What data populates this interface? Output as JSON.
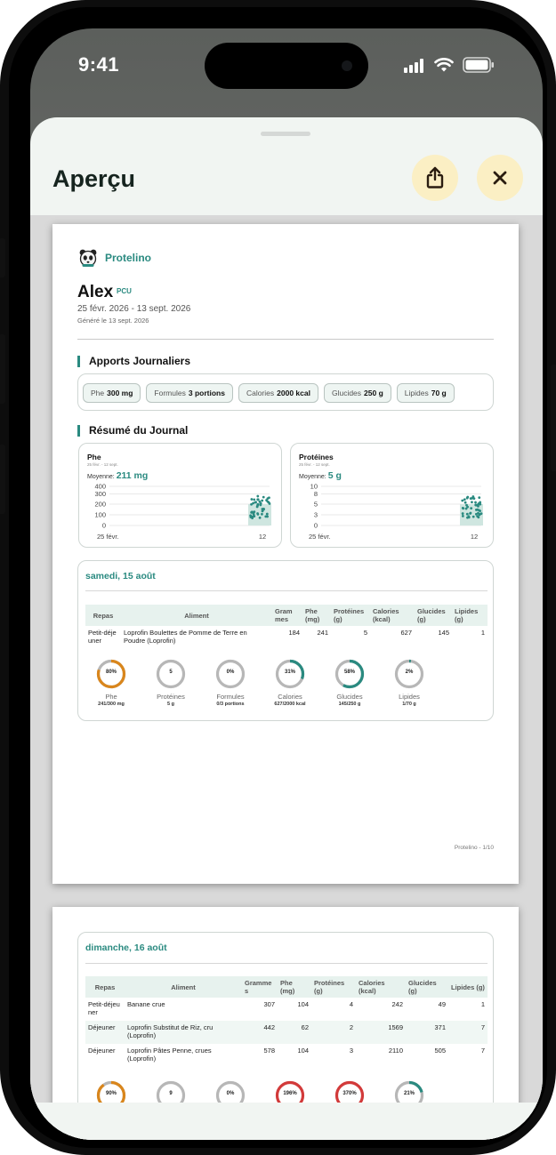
{
  "status_bar": {
    "time": "9:41"
  },
  "sheet": {
    "title": "Aperçu",
    "share_icon": "share-icon",
    "close_icon": "close-icon"
  },
  "report": {
    "brand": "Protelino",
    "patient_name": "Alex",
    "patient_tag": "PCU",
    "period": "25 févr. 2026 - 13 sept. 2026",
    "generated": "Généré le 13 sept. 2026",
    "daily_section_title": "Apports Journaliers",
    "daily_chips": [
      {
        "label": "Phe",
        "value": "300 mg"
      },
      {
        "label": "Formules",
        "value": "3 portions"
      },
      {
        "label": "Calories",
        "value": "2000 kcal"
      },
      {
        "label": "Glucides",
        "value": "250 g"
      },
      {
        "label": "Lipides",
        "value": "70 g"
      }
    ],
    "journal_section_title": "Résumé du Journal",
    "charts": [
      {
        "title": "Phe",
        "range": "25 févr. - 12 sept.",
        "avg_label": "Moyenne:",
        "avg_value": "211 mg",
        "y_ticks": [
          "400",
          "300",
          "200",
          "100",
          "0"
        ],
        "x_ticks": [
          "25 févr.",
          "12"
        ]
      },
      {
        "title": "Protéines",
        "range": "25 févr. - 12 sept.",
        "avg_label": "Moyenne:",
        "avg_value": "5 g",
        "y_ticks": [
          "10",
          "8",
          "5",
          "3",
          "0"
        ],
        "x_ticks": [
          "25 févr.",
          "12"
        ]
      }
    ],
    "table_headers": [
      "Repas",
      "Aliment",
      "Grammes",
      "Phe (mg)",
      "Protéines (g)",
      "Calories (kcal)",
      "Glucides (g)",
      "Lipides (g)"
    ],
    "table_headers_page1": [
      "Repas",
      "Aliment",
      "Gram mes",
      "Phe (mg)",
      "Protéines (g)",
      "Calories (kcal)",
      "Glucides (g)",
      "Lipides (g)"
    ],
    "table_headers_page2": [
      "Repas",
      "Aliment",
      "Gramme s",
      "Phe (mg)",
      "Protéines (g)",
      "Calories (kcal)",
      "Glucides (g)",
      "Lipides (g)"
    ],
    "days": [
      {
        "title": "samedi, 15 août",
        "rows": [
          {
            "meal": "Petit-déje uner",
            "food": "Loprofin Boulettes de Pomme de Terre en Poudre (Loprofin)",
            "grams": "184",
            "phe": "241",
            "protein": "5",
            "calories": "627",
            "carbs": "145",
            "fat": "1"
          }
        ],
        "rings": [
          {
            "pct": "80%",
            "label": "Phe",
            "value": "241/300 mg",
            "fraction": 0.8,
            "color": "#d9861c"
          },
          {
            "pct": "5",
            "label": "Protéines",
            "value": "5 g",
            "fraction": 0,
            "color": "#aaaaaa"
          },
          {
            "pct": "0%",
            "label": "Formules",
            "value": "0/3 portions",
            "fraction": 0,
            "color": "#aaaaaa"
          },
          {
            "pct": "31%",
            "label": "Calories",
            "value": "627/2000 kcal",
            "fraction": 0.31,
            "color": "#2a8a80"
          },
          {
            "pct": "58%",
            "label": "Glucides",
            "value": "145/250 g",
            "fraction": 0.58,
            "color": "#2a8a80"
          },
          {
            "pct": "2%",
            "label": "Lipides",
            "value": "1/70 g",
            "fraction": 0.02,
            "color": "#2a8a80"
          }
        ]
      },
      {
        "title": "dimanche, 16 août",
        "rows": [
          {
            "meal": "Petit-déjeu ner",
            "food": "Banane crue",
            "grams": "307",
            "phe": "104",
            "protein": "4",
            "calories": "242",
            "carbs": "49",
            "fat": "1"
          },
          {
            "meal": "Déjeuner",
            "food": "Loprofin Substitut de Riz, cru (Loprofin)",
            "grams": "442",
            "phe": "62",
            "protein": "2",
            "calories": "1569",
            "carbs": "371",
            "fat": "7"
          },
          {
            "meal": "Déjeuner",
            "food": "Loprofin Pâtes Penne, crues (Loprofin)",
            "grams": "578",
            "phe": "104",
            "protein": "3",
            "calories": "2110",
            "carbs": "505",
            "fat": "7"
          }
        ],
        "rings": [
          {
            "pct": "90%",
            "fraction": 0.9,
            "color": "#d9861c"
          },
          {
            "pct": "9",
            "fraction": 0,
            "color": "#aaaaaa"
          },
          {
            "pct": "0%",
            "fraction": 0,
            "color": "#aaaaaa"
          },
          {
            "pct": "196%",
            "fraction": 1,
            "color": "#d23a3a"
          },
          {
            "pct": "370%",
            "fraction": 1,
            "color": "#d23a3a"
          },
          {
            "pct": "21%",
            "fraction": 0.21,
            "color": "#2a8a80"
          }
        ]
      }
    ],
    "page_footer": "Protelino - 1/10"
  },
  "colors": {
    "accent": "#2a8a80",
    "warning": "#d9861c",
    "over": "#d23a3a",
    "button_bg": "#fbefc4"
  }
}
